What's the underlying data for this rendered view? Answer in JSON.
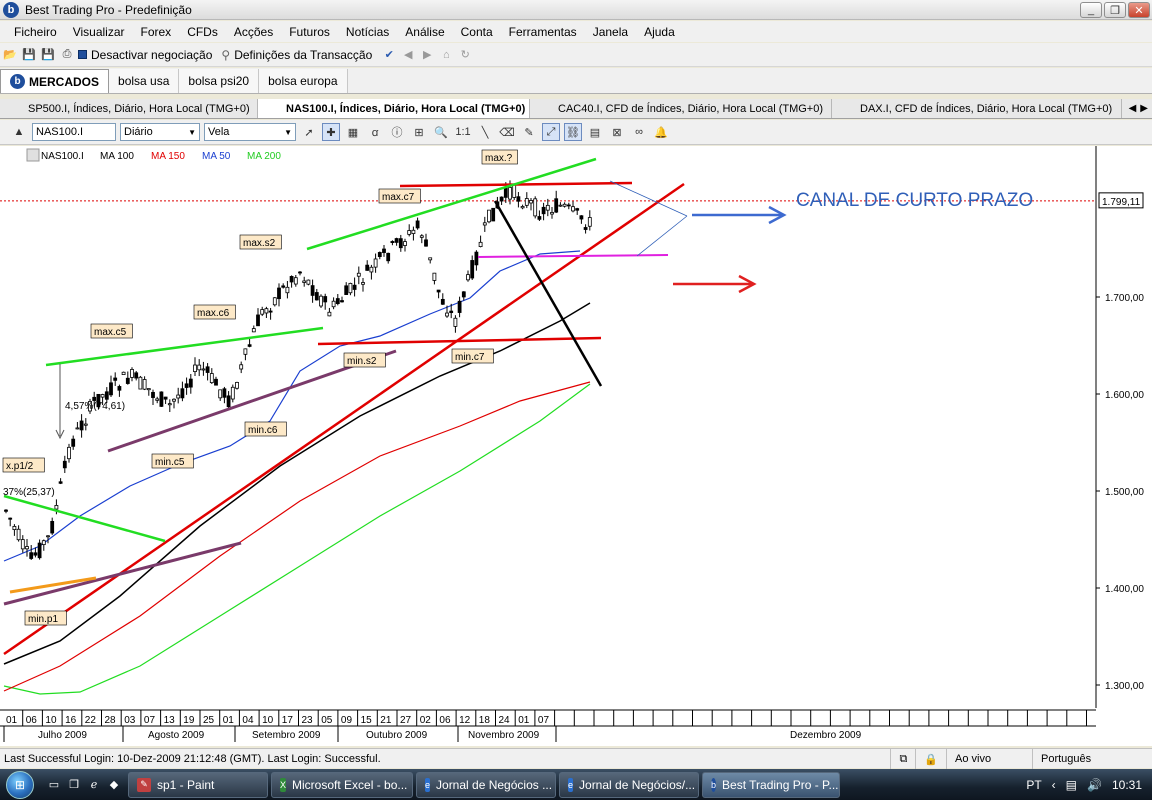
{
  "window": {
    "title": "Best Trading Pro - Predefinição",
    "logo": "b"
  },
  "menu": [
    "Ficheiro",
    "Visualizar",
    "Forex",
    "CFDs",
    "Acções",
    "Futuros",
    "Notícias",
    "Análise",
    "Conta",
    "Ferramentas",
    "Janela",
    "Ajuda"
  ],
  "toolbar": {
    "deactivate_label": "Desactivar negociação",
    "transaction_label": "Definições da Transacção"
  },
  "market_tabs": [
    "MERCADOS",
    "bolsa usa",
    "bolsa psi20",
    "bolsa europa"
  ],
  "chart_tabs": [
    "SP500.I, Índices, Diário, Hora Local (TMG+0)",
    "NAS100.I, Índices, Diário, Hora Local (TMG+0)",
    "CAC40.I, CFD de Índices, Diário, Hora Local (TMG+0)",
    "DAX.I, CFD de Índices, Diário, Hora Local (TMG+0)"
  ],
  "chart_toolbar": {
    "symbol": "NAS100.I",
    "period": "Diário",
    "style": "Vela"
  },
  "legend": [
    {
      "label": "NAS100.I",
      "color": "#000000"
    },
    {
      "label": "MA 100",
      "color": "#000000"
    },
    {
      "label": "MA 150",
      "color": "#e00000"
    },
    {
      "label": "MA 50",
      "color": "#1a3fd0"
    },
    {
      "label": "MA 200",
      "color": "#22cc22"
    }
  ],
  "annotations": {
    "canal": "CANAL DE CURTO PRAZO",
    "labels": [
      "max.?",
      "max.c7",
      "max.s2",
      "max.c6",
      "max.c5",
      "min.s2",
      "min.c7",
      "min.c6",
      "min.c5",
      "x.p1/2",
      "min.p1"
    ],
    "fib_pct1": "4,57%(74,61)",
    "fib_pct2": "37%(25,37)",
    "price_marker": "1.799,11"
  },
  "chart_data": {
    "type": "candlestick",
    "symbol": "NAS100.I",
    "y_ticks": [
      "1.700,00",
      "1.600,00",
      "1.500,00",
      "1.400,00",
      "1.300,00"
    ],
    "last_price": 1799.11,
    "x_days": [
      "01",
      "06",
      "10",
      "16",
      "22",
      "28",
      "03",
      "07",
      "13",
      "19",
      "25",
      "01",
      "04",
      "10",
      "17",
      "23",
      "05",
      "09",
      "15",
      "21",
      "27",
      "02",
      "06",
      "12",
      "18",
      "24",
      "01",
      "07"
    ],
    "x_months": [
      "Julho 2009",
      "Agosto 2009",
      "Setembro 2009",
      "Outubro 2009",
      "Novembro 2009",
      "Dezembro 2009"
    ]
  },
  "status": {
    "left": "Last Successful Login: 10-Dez-2009 21:12:48 (GMT). Last Login: Successful.",
    "mode": "Ao vivo",
    "language": "Português"
  },
  "taskbar": {
    "tasks": [
      "sp1 - Paint",
      "Microsoft Excel - bo...",
      "Jornal de Negócios ...",
      "Jornal de Negócios/...",
      "Best Trading Pro - P..."
    ],
    "lang": "PT",
    "clock": "10:31"
  }
}
